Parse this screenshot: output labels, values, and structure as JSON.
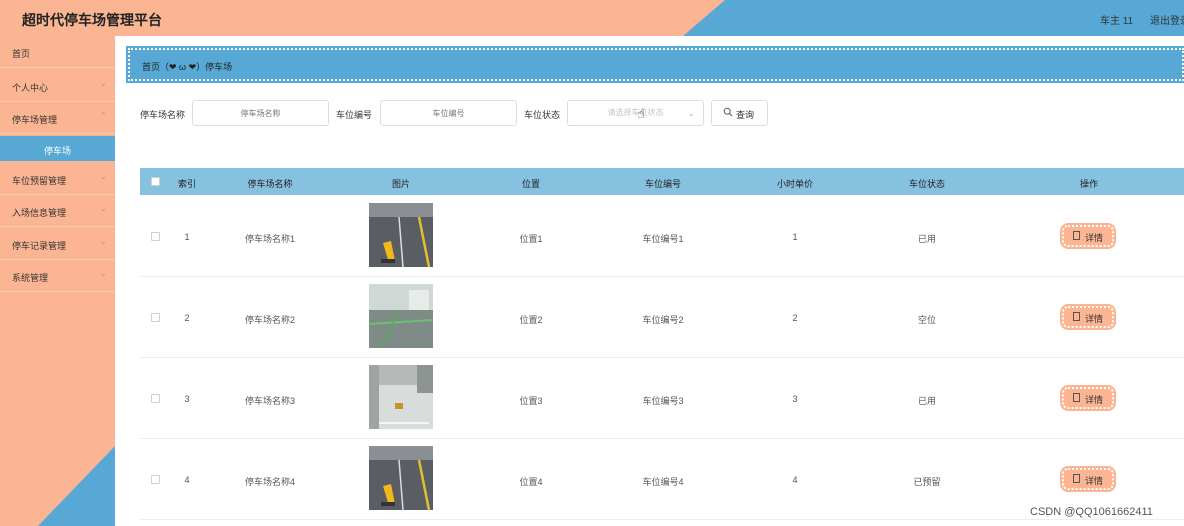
{
  "header": {
    "title": "超时代停车场管理平台",
    "user": "车主 11",
    "logout": "退出登录"
  },
  "sidebar": {
    "items": [
      {
        "label": "首页"
      },
      {
        "label": "个人中心"
      },
      {
        "label": "停车场管理"
      },
      {
        "label": "车位预留管理"
      },
      {
        "label": "入场信息管理"
      },
      {
        "label": "停车记录管理"
      },
      {
        "label": "系统管理"
      }
    ],
    "sub_item": "停车场"
  },
  "breadcrumb": "首页（❤ ω ❤）停车场",
  "search": {
    "name_label": "停车场名称",
    "name_placeholder": "停车场名称",
    "code_label": "车位编号",
    "code_placeholder": "车位编号",
    "status_label": "车位状态",
    "status_placeholder": "请选择车位状态",
    "query_label": "查询"
  },
  "table": {
    "headers": [
      "索引",
      "停车场名称",
      "图片",
      "位置",
      "车位编号",
      "小时单价",
      "车位状态",
      "操作"
    ],
    "rows": [
      {
        "index": "1",
        "name": "停车场名称1",
        "location": "位置1",
        "code": "车位编号1",
        "price": "1",
        "status": "已用",
        "action": "详情"
      },
      {
        "index": "2",
        "name": "停车场名称2",
        "location": "位置2",
        "code": "车位编号2",
        "price": "2",
        "status": "空位",
        "action": "详情"
      },
      {
        "index": "3",
        "name": "停车场名称3",
        "location": "位置3",
        "code": "车位编号3",
        "price": "3",
        "status": "已用",
        "action": "详情"
      },
      {
        "index": "4",
        "name": "停车场名称4",
        "location": "位置4",
        "code": "车位编号4",
        "price": "4",
        "status": "已预留",
        "action": "详情"
      }
    ]
  },
  "watermark": "CSDN @QQ1061662411",
  "colors": {
    "peach": "#fbb592",
    "blue": "#58a8d6",
    "header_row": "#87c1e0"
  }
}
